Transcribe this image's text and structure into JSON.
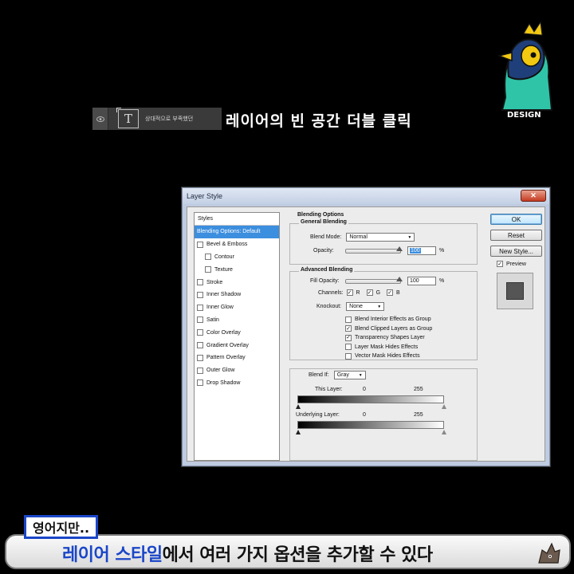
{
  "layer": {
    "name": "상대적으로 부족했던",
    "thumb_glyph": "T"
  },
  "caption_top": "레이어의 빈 공간 더블 클릭",
  "mascot": {
    "label": "DESIGN"
  },
  "dialog": {
    "title": "Layer Style",
    "close_glyph": "✕",
    "styles_header": "Styles",
    "styles": [
      {
        "label": "Blending Options: Default",
        "selected": true,
        "checkbox": false,
        "sub": false
      },
      {
        "label": "Bevel & Emboss",
        "checkbox": true,
        "sub": false
      },
      {
        "label": "Contour",
        "checkbox": true,
        "sub": true
      },
      {
        "label": "Texture",
        "checkbox": true,
        "sub": true
      },
      {
        "label": "Stroke",
        "checkbox": true,
        "sub": false
      },
      {
        "label": "Inner Shadow",
        "checkbox": true,
        "sub": false
      },
      {
        "label": "Inner Glow",
        "checkbox": true,
        "sub": false
      },
      {
        "label": "Satin",
        "checkbox": true,
        "sub": false
      },
      {
        "label": "Color Overlay",
        "checkbox": true,
        "sub": false
      },
      {
        "label": "Gradient Overlay",
        "checkbox": true,
        "sub": false
      },
      {
        "label": "Pattern Overlay",
        "checkbox": true,
        "sub": false
      },
      {
        "label": "Outer Glow",
        "checkbox": true,
        "sub": false
      },
      {
        "label": "Drop Shadow",
        "checkbox": true,
        "sub": false
      }
    ],
    "blending": {
      "section_title": "Blending Options",
      "general_title": "General Blending",
      "blend_mode_label": "Blend Mode:",
      "blend_mode_value": "Normal",
      "opacity_label": "Opacity:",
      "opacity_value": "100",
      "pct": "%",
      "advanced_title": "Advanced Blending",
      "fill_opacity_label": "Fill Opacity:",
      "fill_opacity_value": "100",
      "channels_label": "Channels:",
      "channels": [
        "R",
        "G",
        "B"
      ],
      "knockout_label": "Knockout:",
      "knockout_value": "None",
      "options": [
        {
          "label": "Blend Interior Effects as Group",
          "checked": false
        },
        {
          "label": "Blend Clipped Layers as Group",
          "checked": true
        },
        {
          "label": "Transparency Shapes Layer",
          "checked": true
        },
        {
          "label": "Layer Mask Hides Effects",
          "checked": false
        },
        {
          "label": "Vector Mask Hides Effects",
          "checked": false
        }
      ],
      "blend_if_label": "Blend If:",
      "blend_if_value": "Gray",
      "this_layer_label": "This Layer:",
      "underlying_label": "Underlying Layer:",
      "range_min": "0",
      "range_max": "255"
    },
    "buttons": {
      "ok": "OK",
      "reset": "Reset",
      "new_style": "New Style...",
      "preview": "Preview",
      "preview_checked": true
    },
    "check_glyph": "✓"
  },
  "bottom": {
    "tag": "영어지만..",
    "caption_highlight": "레이어 스타일",
    "caption_rest": "에서 여러 가지 옵션을 추가할 수 있다"
  }
}
